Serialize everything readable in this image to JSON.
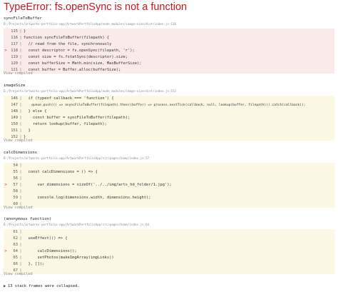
{
  "error": {
    "title": "TypeError: fs.openSync is not a function"
  },
  "frames": [
    {
      "function": "syncFileToBuffer",
      "file": "D:/Projects/artworks-portfolio-app/ArtworkPortfolioApp/node_modules/image-size/dist/index.js:116",
      "highlight": "red",
      "lines": [
        {
          "num": "115",
          "code": "}",
          "marker": ""
        },
        {
          "num": "116",
          "code": "function syncFileToBuffer(filepath) {",
          "marker": ""
        },
        {
          "num": "117",
          "code": "  // read from the file, synchronously",
          "marker": ""
        },
        {
          "num": "118",
          "code": "  const descriptor = fs.openSync(filepath, 'r');",
          "marker": ">"
        },
        {
          "num": "119",
          "code": "  const size = fs.fstatSync(descriptor).size;",
          "marker": ""
        },
        {
          "num": "120",
          "code": "  const bufferSize = Math.min(size, MaxBufferSize);",
          "marker": ""
        },
        {
          "num": "121",
          "code": "  const buffer = Buffer.alloc(bufferSize);",
          "marker": ""
        }
      ],
      "view_compiled": "View compiled"
    },
    {
      "function": "imageSize",
      "file": "D:/Projects/artworks-portfolio-app/ArtworkPortfolioApp/node_modules/image-size/dist/index.js:152",
      "highlight": "yellow",
      "lines": [
        {
          "num": "146",
          "code": "  if (typeof callback === 'function') {",
          "marker": ""
        },
        {
          "num": "147",
          "code": "    queue.push(() => asyncFileToBuffer(filepath).then((buffer) => process.nextTick(callback, null, lookup(buffer, filepath))).catch(callback));",
          "marker": ""
        },
        {
          "num": "148",
          "code": "  } else {",
          "marker": ""
        },
        {
          "num": "149",
          "code": "    const buffer = syncFileToBuffer(filepath);",
          "marker": ""
        },
        {
          "num": "150",
          "code": "    return lookup(buffer, filepath);",
          "marker": ""
        },
        {
          "num": "151",
          "code": "  }",
          "marker": ""
        },
        {
          "num": "152",
          "code": "}",
          "marker": ""
        }
      ],
      "view_compiled": "View compiled"
    },
    {
      "function": "calcDimensions",
      "file": "D:/Projects/artworks-portfolio-app/ArtworkPortfolioApp/src/pages/home/index.js:57",
      "highlight": "yellow",
      "lines": [
        {
          "num": "54",
          "code": "",
          "marker": ""
        },
        {
          "num": "55",
          "code": "  const calcDimensions = () => {",
          "marker": ""
        },
        {
          "num": "56",
          "code": "",
          "marker": ""
        },
        {
          "num": "57",
          "code": "      var dimensions = sizeOf('../../img/arts_hd_folder/1.jpg');",
          "marker": ">"
        },
        {
          "num": "58",
          "code": "",
          "marker": ""
        },
        {
          "num": "59",
          "code": "      console.log(dimensions.width, dimensions.height);",
          "marker": ""
        },
        {
          "num": "60",
          "code": "",
          "marker": ""
        }
      ],
      "view_compiled": "View compiled"
    },
    {
      "function": "(anonymous function)",
      "file": "D:/Projects/artworks-portfolio-app/ArtworkPortfolioApp/src/pages/home/index.js:64",
      "highlight": "yellow",
      "lines": [
        {
          "num": "61",
          "code": "",
          "marker": ""
        },
        {
          "num": "62",
          "code": "  useEffect(() => {",
          "marker": ""
        },
        {
          "num": "63",
          "code": "",
          "marker": ""
        },
        {
          "num": "64",
          "code": "      calcDimensions();",
          "marker": ">"
        },
        {
          "num": "65",
          "code": "      setPhotos(makeImgArray(imgLinks))",
          "marker": ""
        },
        {
          "num": "66",
          "code": "  }, []);",
          "marker": ""
        },
        {
          "num": "67",
          "code": "",
          "marker": ""
        }
      ],
      "view_compiled": "View compiled"
    }
  ],
  "collapsed": {
    "icon": "triangle-right-icon",
    "text": "13 stack frames were collapsed."
  },
  "colors": {
    "error": "#c8171e",
    "red_bg": "#fbeaea",
    "yellow_bg": "#fdf8e4",
    "muted": "#8a8a8a"
  }
}
